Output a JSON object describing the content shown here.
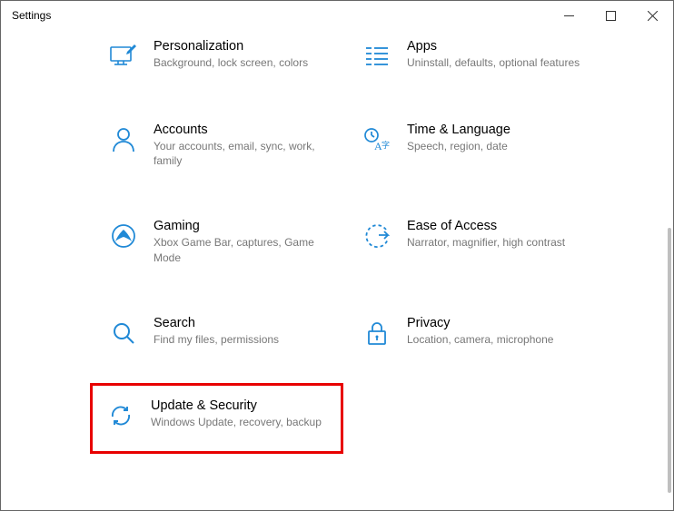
{
  "window": {
    "title": "Settings"
  },
  "tiles": [
    {
      "title": "Personalization",
      "sub": "Background, lock screen, colors"
    },
    {
      "title": "Apps",
      "sub": "Uninstall, defaults, optional features"
    },
    {
      "title": "Accounts",
      "sub": "Your accounts, email, sync, work, family"
    },
    {
      "title": "Time & Language",
      "sub": "Speech, region, date"
    },
    {
      "title": "Gaming",
      "sub": "Xbox Game Bar, captures, Game Mode"
    },
    {
      "title": "Ease of Access",
      "sub": "Narrator, magnifier, high contrast"
    },
    {
      "title": "Search",
      "sub": "Find my files, permissions"
    },
    {
      "title": "Privacy",
      "sub": "Location, camera, microphone"
    },
    {
      "title": "Update & Security",
      "sub": "Windows Update, recovery, backup"
    }
  ],
  "colors": {
    "accent": "#0078d4",
    "highlight": "#e80000"
  }
}
